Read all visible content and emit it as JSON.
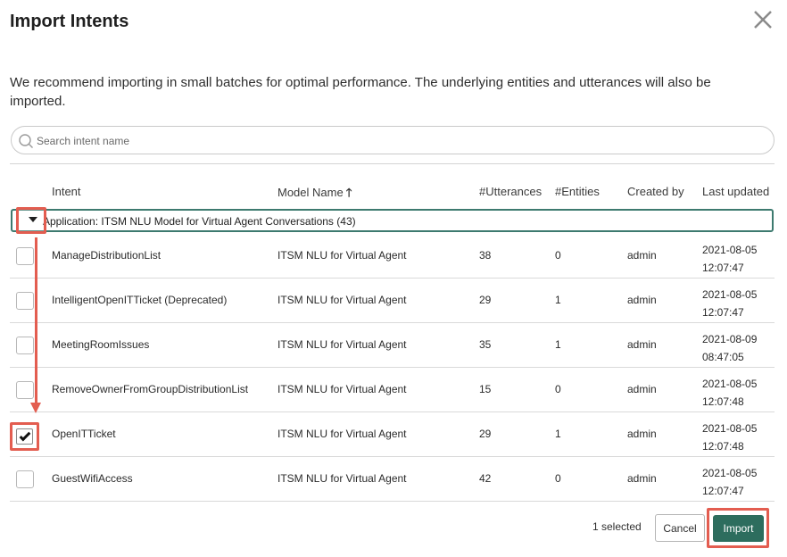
{
  "dialog": {
    "title": "Import Intents",
    "description": "We recommend importing in small batches for optimal performance. The underlying entities and utterances will also be imported."
  },
  "search": {
    "placeholder": "Search intent name",
    "value": ""
  },
  "table": {
    "headers": {
      "intent": "Intent",
      "model": "Model Name",
      "model_sort_arrow": "🡑",
      "utterances": "#Utterances",
      "entities": "#Entities",
      "created_by": "Created by",
      "last_updated": "Last updated"
    },
    "group": {
      "label": "Application: ITSM NLU Model for Virtual Agent Conversations (43)",
      "expanded": true
    },
    "rows": [
      {
        "intent": "ManageDistributionList",
        "model": "ITSM NLU for Virtual Agent",
        "utterances": "38",
        "entities": "0",
        "created_by": "admin",
        "date": "2021-08-05",
        "time": "12:07:47",
        "checked": false
      },
      {
        "intent": "IntelligentOpenITTicket (Deprecated)",
        "model": "ITSM NLU for Virtual Agent",
        "utterances": "29",
        "entities": "1",
        "created_by": "admin",
        "date": "2021-08-05",
        "time": "12:07:47",
        "checked": false
      },
      {
        "intent": "MeetingRoomIssues",
        "model": "ITSM NLU for Virtual Agent",
        "utterances": "35",
        "entities": "1",
        "created_by": "admin",
        "date": "2021-08-09",
        "time": "08:47:05",
        "checked": false
      },
      {
        "intent": "RemoveOwnerFromGroupDistributionList",
        "model": "ITSM NLU for Virtual Agent",
        "utterances": "15",
        "entities": "0",
        "created_by": "admin",
        "date": "2021-08-05",
        "time": "12:07:48",
        "checked": false
      },
      {
        "intent": "OpenITTicket",
        "model": "ITSM NLU for Virtual Agent",
        "utterances": "29",
        "entities": "1",
        "created_by": "admin",
        "date": "2021-08-05",
        "time": "12:07:48",
        "checked": true
      },
      {
        "intent": "GuestWifiAccess",
        "model": "ITSM NLU for Virtual Agent",
        "utterances": "42",
        "entities": "0",
        "created_by": "admin",
        "date": "2021-08-05",
        "time": "12:07:47",
        "checked": false
      }
    ]
  },
  "footer": {
    "selected_text": "1 selected",
    "cancel_label": "Cancel",
    "import_label": "Import"
  },
  "colors": {
    "primary": "#2d6d5e",
    "group_border": "#3d7a6f",
    "highlight": "#e35d50"
  },
  "icons": {
    "close": "close-icon",
    "search": "search-icon",
    "expand": "caret-down-icon",
    "check": "checkmark-icon"
  }
}
